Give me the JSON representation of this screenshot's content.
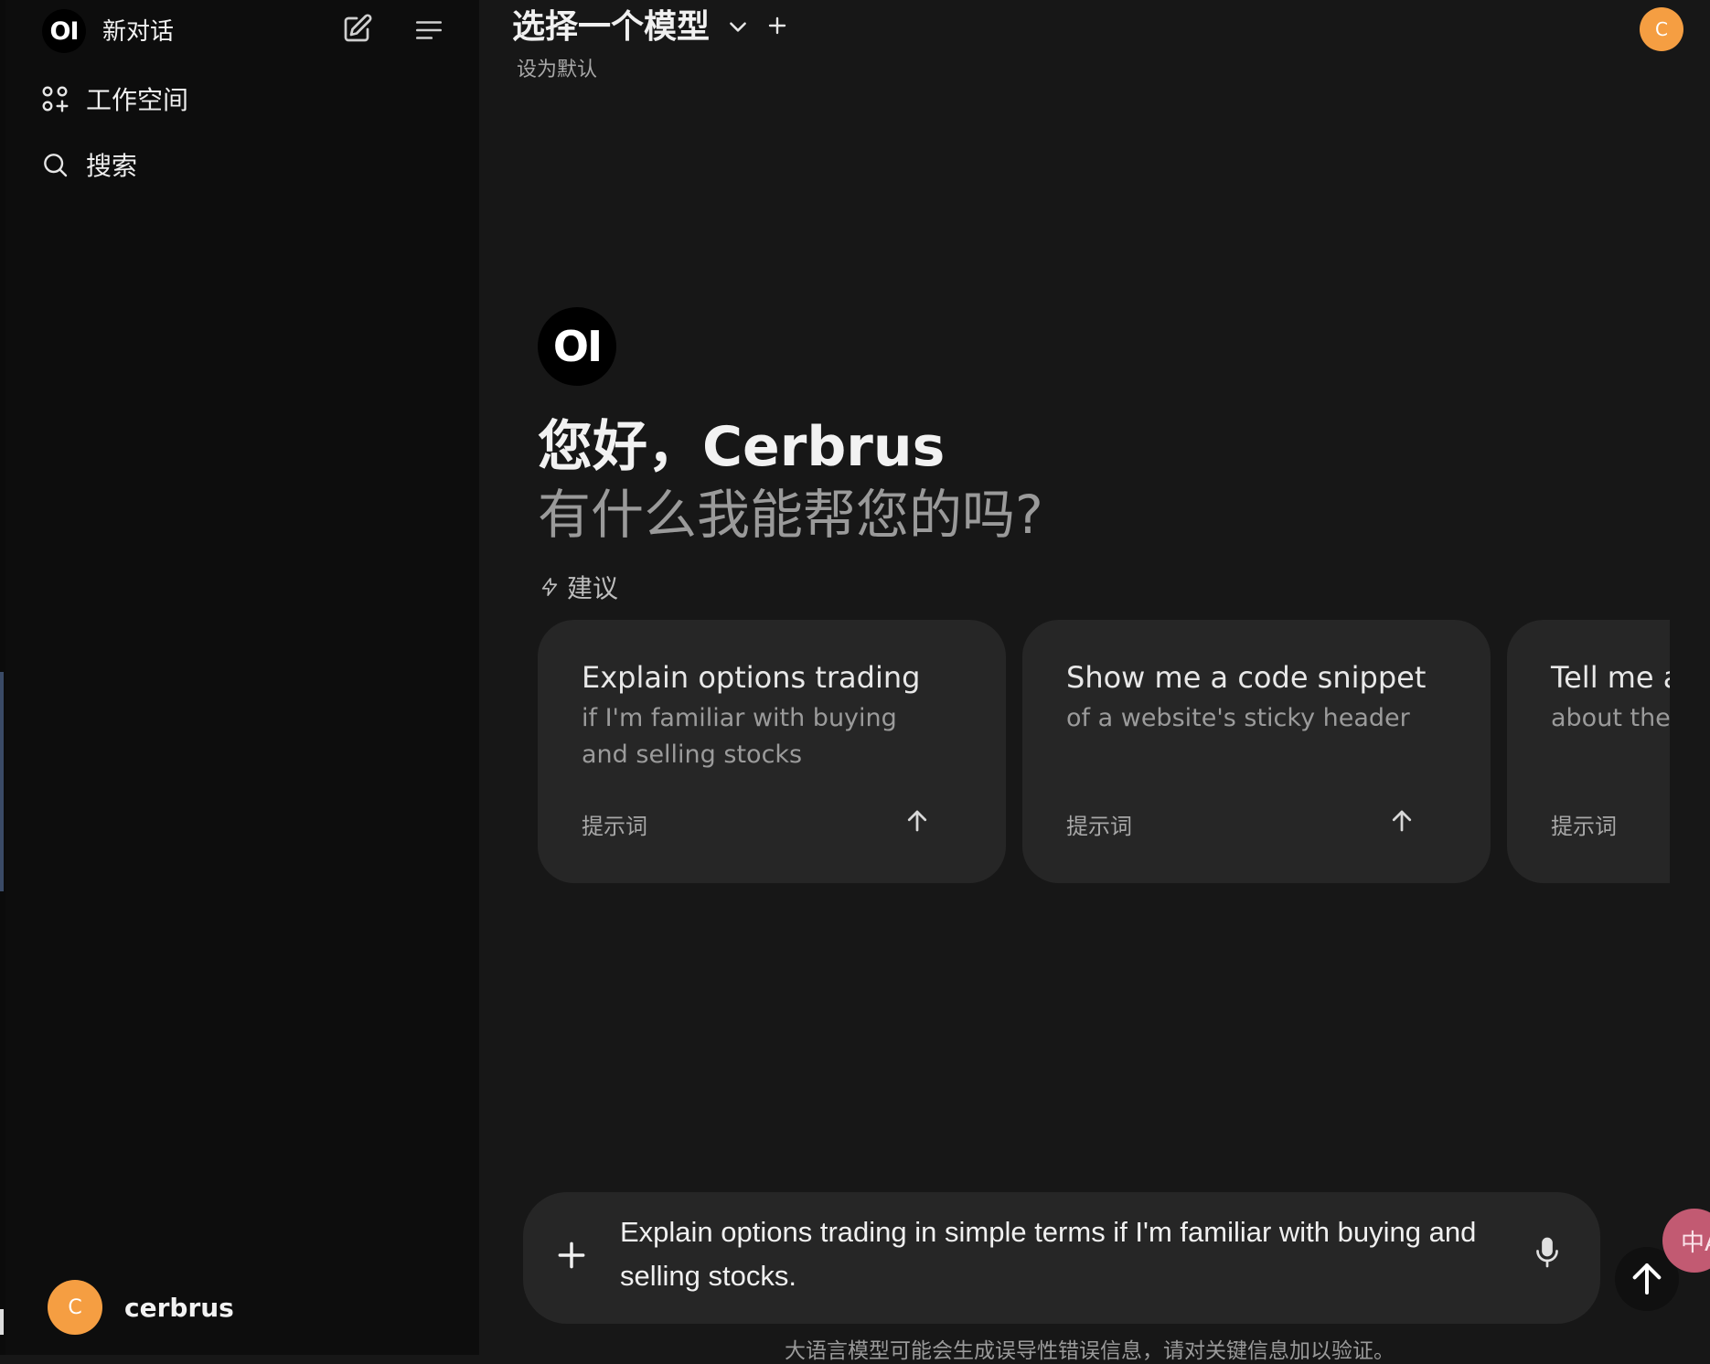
{
  "sidebar": {
    "logo_text": "OI",
    "new_chat_label": "新对话",
    "items": [
      {
        "label": "工作空间",
        "icon": "workspace-grid-icon"
      },
      {
        "label": "搜索",
        "icon": "search-icon"
      }
    ],
    "user": {
      "avatar_initial": "C",
      "name": "cerbrus"
    }
  },
  "header": {
    "model_selector_label": "选择一个模型",
    "set_default_label": "设为默认",
    "avatar_initial": "C"
  },
  "hero": {
    "logo_text": "OI",
    "greeting": "您好，Cerbrus",
    "subtitle": "有什么我能帮您的吗?"
  },
  "suggestions": {
    "label": "建议",
    "cards": [
      {
        "title": "Explain options trading",
        "subtitle": "if I'm familiar with buying and selling stocks",
        "tag": "提示词"
      },
      {
        "title": "Show me a code snippet",
        "subtitle": "of a website's sticky header",
        "tag": "提示词"
      },
      {
        "title": "Tell me a",
        "subtitle": "about the I",
        "tag": "提示词"
      }
    ]
  },
  "composer": {
    "input_value": "Explain options trading in simple terms if I'm familiar with buying and selling stocks."
  },
  "translate_widget": {
    "label": "中A"
  },
  "footer": {
    "disclaimer": "大语言模型可能会生成误导性错误信息，请对关键信息加以验证。"
  },
  "colors": {
    "background": "#171717",
    "sidebar": "#0d0d0d",
    "card": "#262626",
    "avatar": "#f59e42",
    "translate_widget": "#c25a72"
  }
}
